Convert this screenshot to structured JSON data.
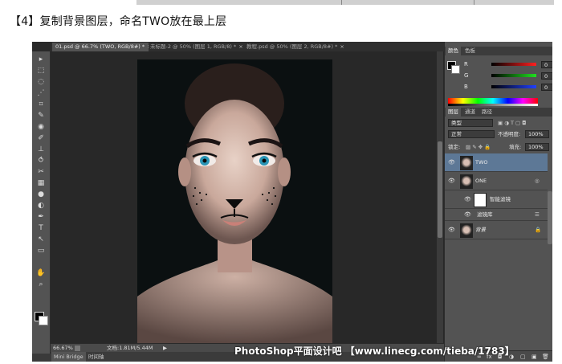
{
  "caption": "【4】复制背景图层，命名TWO放在最上层",
  "tabs": [
    {
      "label": "01.psd @ 66.7% (TWO, RGB/8#) *",
      "active": true
    },
    {
      "label": "未标题-2 @ 50% (图层 1, RGB/8) *",
      "active": false
    },
    {
      "label": "教程.psd @ 50% (图层 2, RGB/8#) *",
      "active": false
    }
  ],
  "tab_close": "×",
  "tools": [
    "▸",
    "⬚",
    "◌",
    "⋰",
    "⌗",
    "✎",
    "◉",
    "✐",
    "⊥",
    "⥀",
    "✂",
    "▦",
    "●",
    "◐",
    "✒",
    "T",
    "↖",
    "▭",
    "✋",
    "⌕"
  ],
  "status": {
    "zoom": "66.67%",
    "doc": "文档:1.81M/5.44M",
    "arrow": "▶"
  },
  "mini_bridge": {
    "tab1": "Mini Bridge",
    "tab2": "时间轴"
  },
  "panel_tabs_top": {
    "color": "颜色",
    "swatches": "色板"
  },
  "color_panel": {
    "rows": [
      {
        "label": "R",
        "value": "0",
        "color": "#e03030"
      },
      {
        "label": "G",
        "value": "0",
        "color": "#30c030"
      },
      {
        "label": "B",
        "value": "0",
        "color": "#3050e0"
      }
    ]
  },
  "layer_tabs": {
    "layers": "图层",
    "channels": "通道",
    "paths": "路径"
  },
  "layers_panel": {
    "filter_kind": "类型",
    "blend_mode": "正常",
    "opacity_label": "不透明度:",
    "opacity_value": "100%",
    "lock_label": "锁定:",
    "fill_label": "填充:",
    "fill_value": "100%",
    "layers": [
      {
        "name": "TWO",
        "selected": true
      },
      {
        "name": "ONE",
        "selected": false
      },
      {
        "name": "智能滤镜",
        "selected": false
      },
      {
        "name": "滤镜库",
        "selected": false
      },
      {
        "name": "背景",
        "selected": false
      }
    ],
    "bottom_icons": [
      "fx",
      "◘",
      "◑",
      "▢",
      "▣",
      "🗑"
    ]
  },
  "watermark": "PhotoShop平面设计吧 【www.linecg.com/tieba/1783】"
}
